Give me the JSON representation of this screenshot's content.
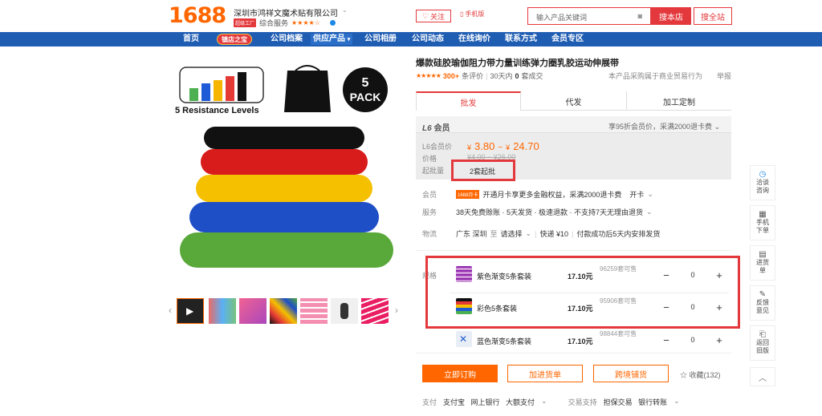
{
  "header": {
    "logo": "1688",
    "company": "深圳市鸿祥文魔术贴有限公司",
    "year_badge": "超级工厂",
    "service_label": "综合服务",
    "stars": "★★★★☆",
    "follow": "关注",
    "mobile": "手机版",
    "search_placeholder": "输入产品关键词",
    "search_store": "搜本店",
    "search_all": "搜全站"
  },
  "nav": {
    "home": "首页",
    "special": "镇店之宝",
    "archive": "公司档案",
    "supply": "供应产品",
    "album": "公司相册",
    "news": "公司动态",
    "inquiry": "在线询价",
    "contact": "联系方式",
    "member": "会员专区"
  },
  "product": {
    "title": "爆款硅胶瑜伽阻力带力量训练弹力圈乳胶运动伸展带",
    "stars": "★★★★★",
    "reviews": "300+",
    "reviews_label": "条评价",
    "month_sales_pre": "30天内",
    "month_sales": "0",
    "month_sales_post": "套成交",
    "purchase_note": "本产品采购属于商业贸易行为",
    "report": "举报"
  },
  "tabs": [
    "批发",
    "代发",
    "加工定制"
  ],
  "pricing": {
    "level": "L6",
    "level_suffix": "会员",
    "promo": "享95折会员价，采满2000退卡费",
    "member_price_label": "L6会员价",
    "price_label": "价格",
    "price_low": "3.80",
    "price_high": "24.70",
    "currency": "¥",
    "old_low": "¥4.00",
    "old_high": "¥26.00",
    "moq_label": "起批量",
    "moq": "2套起批"
  },
  "info": {
    "member_label": "会员",
    "member_badge": "1688月卡",
    "member_text": "开通月卡享更多金融权益，采满2000退卡费",
    "member_action": "开卡",
    "service_label": "服务",
    "service_text": "38天免费赊账 · 5天发货 · 极速退款 · 不支持7天无理由退货",
    "logistics_label": "物流",
    "from": "广东 深圳",
    "to_word": "至",
    "dest": "请选择",
    "shipping": "快递 ¥10",
    "ship_note": "付款成功后5天内安排发货"
  },
  "sku": {
    "label": "规格",
    "unit": "元",
    "variants": [
      {
        "name": "紫色渐变5条套装",
        "price": "17.10元",
        "stock": "96259套可售",
        "qty": "0"
      },
      {
        "name": "彩色5条套装",
        "price": "17.10元",
        "stock": "95906套可售",
        "qty": "0"
      },
      {
        "name": "蓝色渐变5条套装",
        "price": "17.10元",
        "stock": "98844套可售",
        "qty": "0"
      }
    ]
  },
  "actions": {
    "buy": "立即订购",
    "cart": "加进货单",
    "cross": "跨境铺货",
    "fav": "收藏(132)"
  },
  "payment": {
    "label": "支付",
    "methods": "支付宝   网上银行   大额支付",
    "trade_label": "交易支持",
    "trade": "担保交易   银行转账"
  },
  "image_labels": {
    "resistance": "5 Resistance Levels",
    "pack_num": "5",
    "pack_word": "PACK"
  },
  "sidebar": {
    "chat": "洽谈\n咨询",
    "phone": "手机\n下单",
    "cart": "进货\n单",
    "feedback": "反馈\n意见",
    "old": "返回\n旧版"
  },
  "colors": {
    "brand_orange": "#ff6600",
    "accent_red": "#e4393c",
    "nav_blue": "#1f5db3"
  }
}
